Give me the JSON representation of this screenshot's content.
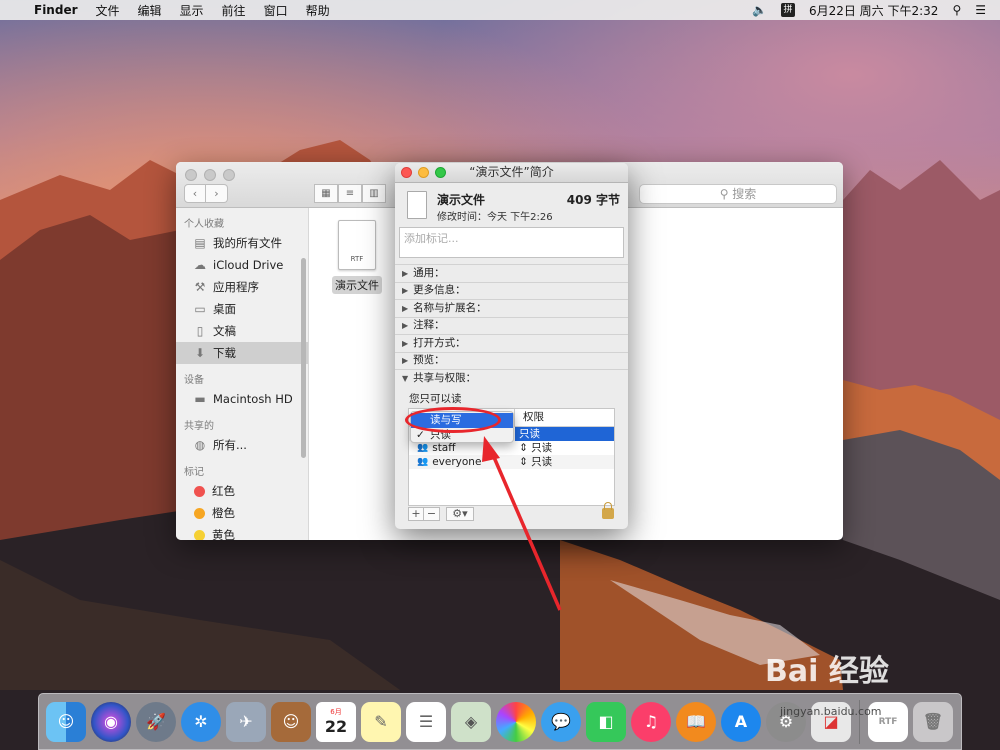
{
  "menubar": {
    "app": "Finder",
    "menus": [
      "文件",
      "编辑",
      "显示",
      "前往",
      "窗口",
      "帮助"
    ],
    "input_icon": "拼",
    "clock": "6月22日 周六 下午2:32"
  },
  "finder": {
    "search_placeholder": "搜索",
    "sidebar": {
      "favorites_header": "个人收藏",
      "favorites": [
        "我的所有文件",
        "iCloud Drive",
        "应用程序",
        "桌面",
        "文稿",
        "下载"
      ],
      "devices_header": "设备",
      "devices": [
        "Macintosh HD"
      ],
      "shared_header": "共享的",
      "shared": [
        "所有..."
      ],
      "tags_header": "标记",
      "tags": [
        {
          "label": "红色",
          "color": "#f0524f"
        },
        {
          "label": "橙色",
          "color": "#f6a623"
        },
        {
          "label": "黄色",
          "color": "#f5d033"
        }
      ]
    },
    "file": {
      "name": "演示文件",
      "type_label": "RTF"
    }
  },
  "info": {
    "title": "“演示文件”简介",
    "name": "演示文件",
    "size": "409 字节",
    "modified": "修改时间：今天 下午2:26",
    "tag_placeholder": "添加标记...",
    "sections": [
      "通用：",
      "更多信息：",
      "名称与扩展名：",
      "注释：",
      "打开方式：",
      "预览：",
      "共享与权限："
    ],
    "permission_note": "您只可以读",
    "perm_table": {
      "col_name": "名称",
      "col_priv": "权限",
      "rows": [
        {
          "name": "",
          "priv": "只读"
        },
        {
          "name": "staff",
          "priv": "只读"
        },
        {
          "name": "everyone",
          "priv": "只读"
        }
      ]
    },
    "popup_options": [
      "读与写",
      "只读"
    ]
  },
  "watermark": {
    "logo": "Bai 经验",
    "url": "jingyan.baidu.com"
  }
}
